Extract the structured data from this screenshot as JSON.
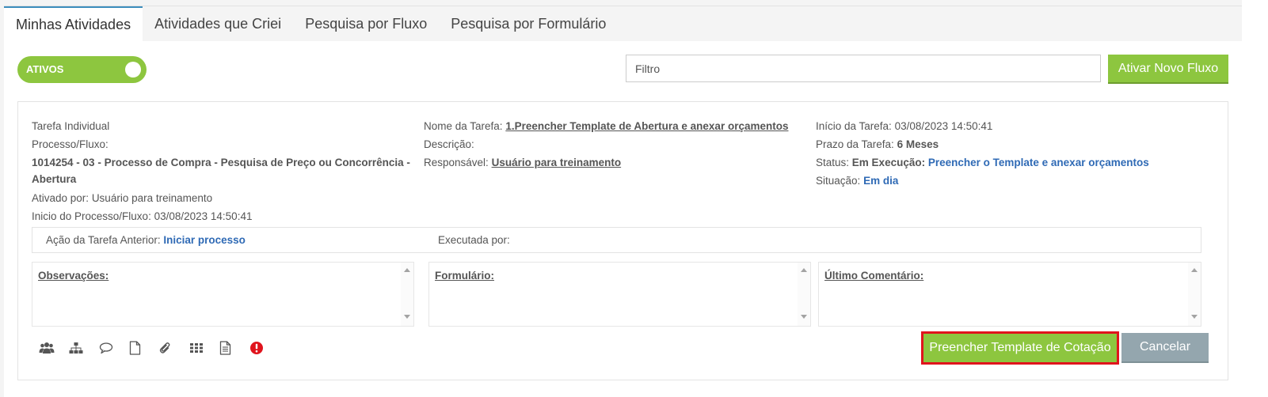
{
  "tabs": [
    {
      "label": "Minhas Atividades",
      "active": true
    },
    {
      "label": "Atividades que Criei",
      "active": false
    },
    {
      "label": "Pesquisa por Fluxo",
      "active": false
    },
    {
      "label": "Pesquisa por Formulário",
      "active": false
    }
  ],
  "toggle": {
    "label": "ATIVOS",
    "on": true
  },
  "filter": {
    "placeholder": "Filtro",
    "value": ""
  },
  "new_flow_button": "Ativar Novo Fluxo",
  "task": {
    "type": "Tarefa Individual",
    "process_label": "Processo/Fluxo:",
    "process_name": "1014254 - 03 - Processo de Compra - Pesquisa de Preço ou Concorrência - Abertura",
    "activated_by_label": "Ativado por:",
    "activated_by": "Usuário para treinamento",
    "process_start_label": "Inicio do Processo/Fluxo:",
    "process_start": "03/08/2023 14:50:41",
    "name_label": "Nome da Tarefa:",
    "name": "1.Preencher Template de Abertura e anexar orçamentos",
    "description_label": "Descrição:",
    "description": "",
    "responsible_label": "Responsável:",
    "responsible": "Usuário para treinamento",
    "task_start_label": "Início da Tarefa:",
    "task_start": "03/08/2023 14:50:41",
    "deadline_label": "Prazo da Tarefa:",
    "deadline": "6 Meses",
    "status_label": "Status:",
    "status": "Em Execução:",
    "status_detail": "Preencher o Template e anexar orçamentos",
    "situation_label": "Situação:",
    "situation": "Em dia"
  },
  "previous_action": {
    "label": "Ação da Tarefa Anterior:",
    "value": "Iniciar processo",
    "executed_by_label": "Executada por:",
    "executed_by": ""
  },
  "boxes": {
    "observations": "Observações:",
    "form": "Formulário:",
    "last_comment": "Último Comentário:"
  },
  "icons": [
    "users-icon",
    "org-chart-icon",
    "comment-icon",
    "document-icon",
    "paperclip-icon",
    "grid-icon",
    "file-text-icon",
    "alert-icon"
  ],
  "colors": {
    "accent_green": "#8dc63f",
    "cancel_gray": "#94a6ae",
    "link_blue": "#2f6ab5",
    "highlight_red": "#e0141d",
    "tab_active_border": "#3c8dbc"
  },
  "actions": {
    "fill_template": "Preencher Template de Cotação",
    "cancel": "Cancelar"
  }
}
